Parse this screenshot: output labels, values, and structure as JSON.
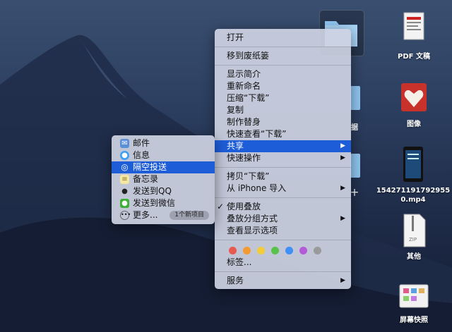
{
  "context_menu": {
    "items": [
      {
        "label": "打开"
      },
      {
        "label": "移到废纸篓"
      },
      {
        "label": "显示简介"
      },
      {
        "label": "重新命名"
      },
      {
        "label": "压缩“下载”"
      },
      {
        "label": "复制"
      },
      {
        "label": "制作替身"
      },
      {
        "label": "快速查看“下载”"
      },
      {
        "label": "共享",
        "arrow": "▶"
      },
      {
        "label": "快速操作",
        "arrow": "▶"
      },
      {
        "label": "拷贝“下载”"
      },
      {
        "label": "从 iPhone 导入",
        "arrow": "▶"
      },
      {
        "label": "使用叠放",
        "check": "✓"
      },
      {
        "label": "叠放分组方式",
        "arrow": "▶"
      },
      {
        "label": "查看显示选项"
      },
      {
        "label": "标签..."
      },
      {
        "label": "服务",
        "arrow": "▶"
      }
    ],
    "tag_colors": [
      "#e8594f",
      "#f39a33",
      "#f4cb39",
      "#58c24b",
      "#3e8ff6",
      "#b35ad9",
      "#9a9a9a"
    ]
  },
  "share_submenu": {
    "items": [
      {
        "label": "邮件",
        "icon": "mail-icon"
      },
      {
        "label": "信息",
        "icon": "messages-icon"
      },
      {
        "label": "隔空投送",
        "icon": "airdrop-icon"
      },
      {
        "label": "备忘录",
        "icon": "notes-icon"
      },
      {
        "label": "发送到QQ",
        "icon": "qq-icon"
      },
      {
        "label": "发送到微信",
        "icon": "wechat-icon"
      },
      {
        "label": "更多...",
        "icon": "more-icon"
      }
    ],
    "new_items_badge": "1个新项目"
  },
  "desktop_items": [
    {
      "label": "PDF 文稿",
      "icon": "pdf-document-icon"
    },
    {
      "label": "图像",
      "icon": "image-icon"
    },
    {
      "label": "1542711917929550.mp4",
      "icon": "video-file-icon"
    },
    {
      "label": "其他",
      "icon": "zip-archive-icon"
    },
    {
      "label": "屏幕快照",
      "icon": "screenshot-icon"
    }
  ],
  "partial_labels": [
    "据",
    "十"
  ],
  "colors": {
    "selection": "#1d5dd7",
    "menu_bg": "#cdd2e2",
    "folder": "#8fc4ef"
  }
}
